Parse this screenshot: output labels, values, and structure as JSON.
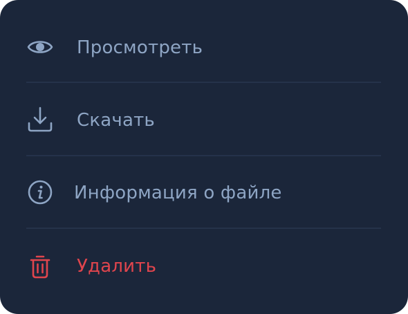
{
  "menu": {
    "items": [
      {
        "label": "Просмотреть",
        "icon": "eye-icon"
      },
      {
        "label": "Скачать",
        "icon": "download-icon"
      },
      {
        "label": "Информация о файле",
        "icon": "info-icon"
      },
      {
        "label": "Удалить",
        "icon": "trash-icon",
        "color": "#e0454d"
      }
    ]
  },
  "colors": {
    "background": "#1b263a",
    "text": "#8ea5c4",
    "danger": "#e0454d",
    "divider": "#25324a"
  }
}
